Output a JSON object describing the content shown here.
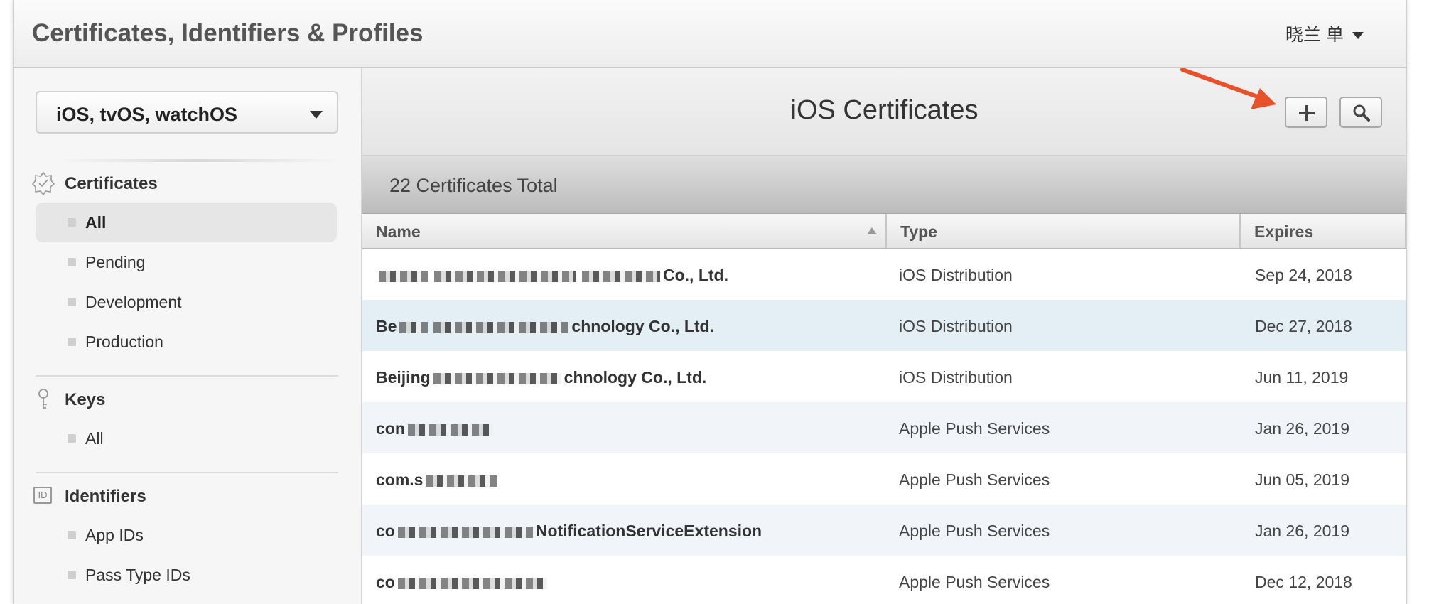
{
  "header": {
    "app_title": "Certificates, Identifiers & Profiles",
    "user_name": "晓兰 单"
  },
  "sidebar": {
    "platform": "iOS, tvOS, watchOS",
    "sections": {
      "certificates": {
        "title": "Certificates",
        "items": [
          "All",
          "Pending",
          "Development",
          "Production"
        ]
      },
      "keys": {
        "title": "Keys",
        "items": [
          "All"
        ]
      },
      "identifiers": {
        "title": "Identifiers",
        "icon_text": "ID",
        "items": [
          "App IDs",
          "Pass Type IDs"
        ]
      }
    },
    "active_item": "All"
  },
  "main": {
    "title": "iOS Certificates",
    "total": "22 Certificates Total",
    "columns": [
      "Name",
      "Type",
      "Expires"
    ],
    "rows": [
      {
        "name_prefix": "",
        "name_suffix": "Co., Ltd.",
        "type": "iOS Distribution",
        "expires": "Sep 24, 2018"
      },
      {
        "name_prefix": "Be",
        "name_suffix": "chnology Co., Ltd.",
        "type": "iOS Distribution",
        "expires": "Dec 27, 2018"
      },
      {
        "name_prefix": "Beijing",
        "name_suffix": "chnology Co., Ltd.",
        "type": "iOS Distribution",
        "expires": "Jun 11, 2019"
      },
      {
        "name_prefix": "con",
        "name_suffix": "",
        "type": "Apple Push Services",
        "expires": "Jan 26, 2019"
      },
      {
        "name_prefix": "com.s",
        "name_suffix": "",
        "type": "Apple Push Services",
        "expires": "Jun 05, 2019"
      },
      {
        "name_prefix": "co",
        "name_suffix": "NotificationServiceExtension",
        "type": "Apple Push Services",
        "expires": "Jan 26, 2019"
      },
      {
        "name_prefix": "co",
        "name_suffix": "",
        "type": "Apple Push Services",
        "expires": "Dec 12, 2018"
      }
    ]
  },
  "colors": {
    "arrow": "#e8512a"
  },
  "icons": {
    "add": "plus-icon",
    "search": "search-icon",
    "certificates": "certificate-badge-icon",
    "keys": "key-icon"
  }
}
